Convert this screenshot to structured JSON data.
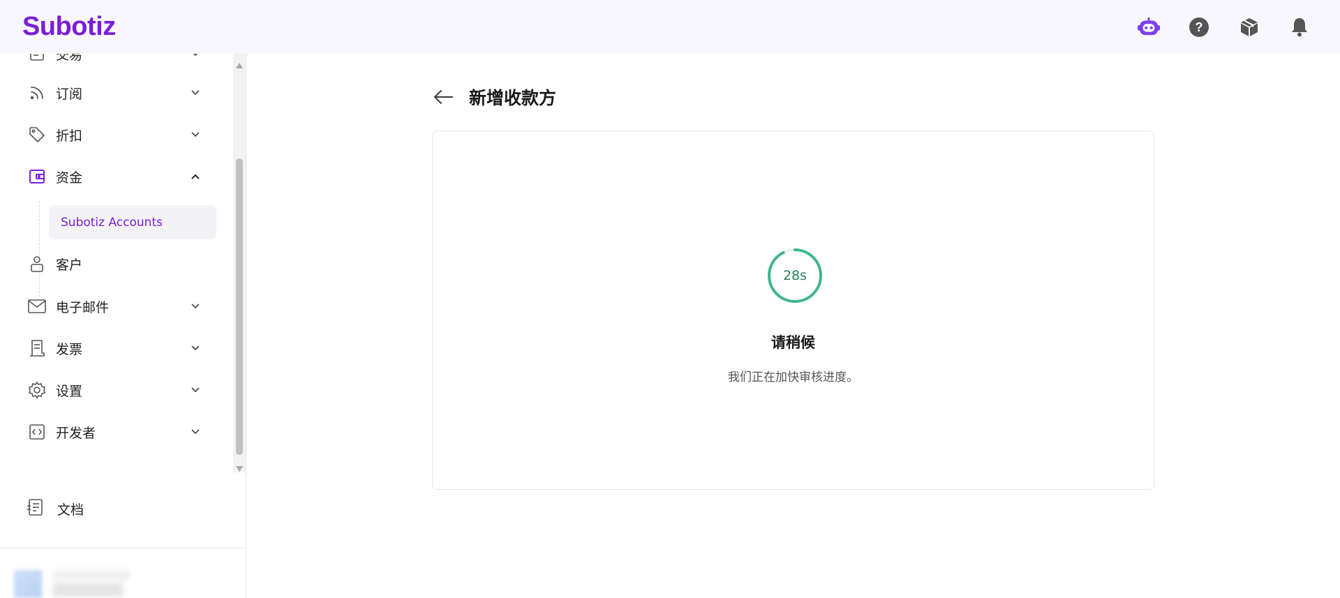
{
  "app": {
    "logo_text": "Subotiz",
    "brand_color": "#7a1fd6"
  },
  "header": {
    "icons": [
      "assistant-bot-icon",
      "help-icon",
      "package-icon",
      "bell-icon"
    ]
  },
  "sidebar": {
    "items": [
      {
        "label": "交易",
        "icon": "ledger-icon",
        "chevron": "down"
      },
      {
        "label": "订阅",
        "icon": "rss-icon",
        "chevron": "down"
      },
      {
        "label": "折扣",
        "icon": "tag-icon",
        "chevron": "down"
      },
      {
        "label": "资金",
        "icon": "wallet-icon",
        "chevron": "up",
        "active": true
      },
      {
        "label": "客户",
        "icon": "user-icon"
      },
      {
        "label": "电子邮件",
        "icon": "mail-icon",
        "chevron": "down"
      },
      {
        "label": "发票",
        "icon": "invoice-icon",
        "chevron": "down"
      },
      {
        "label": "设置",
        "icon": "gear-icon",
        "chevron": "down"
      },
      {
        "label": "开发者",
        "icon": "code-icon",
        "chevron": "down"
      }
    ],
    "submenu": {
      "label": "Subotiz Accounts"
    },
    "docs": {
      "label": "文档",
      "icon": "docs-icon"
    }
  },
  "page": {
    "title": "新增收款方",
    "timer_text": "28s",
    "timer_color": "#3fb68b",
    "wait_title": "请稍候",
    "wait_subtitle": "我们正在加快审核进度。"
  }
}
